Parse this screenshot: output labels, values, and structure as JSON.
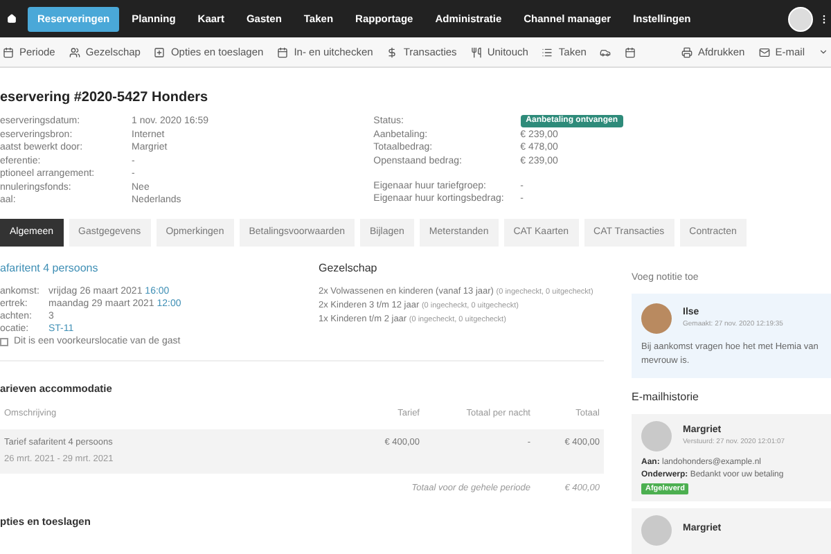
{
  "nav": {
    "items": [
      {
        "label": "Reserveringen",
        "selected": true
      },
      {
        "label": "Planning",
        "selected": false
      },
      {
        "label": "Kaart",
        "selected": false
      },
      {
        "label": "Gasten",
        "selected": false
      },
      {
        "label": "Taken",
        "selected": false
      },
      {
        "label": "Rapportage",
        "selected": false
      },
      {
        "label": "Administratie",
        "selected": false
      },
      {
        "label": "Channel manager",
        "selected": false
      },
      {
        "label": "Instellingen",
        "selected": false
      }
    ]
  },
  "toolbar": {
    "left": [
      {
        "label": "Periode",
        "kind": "calendar"
      },
      {
        "label": "Gezelschap",
        "kind": "users"
      },
      {
        "label": "Opties en toeslagen",
        "kind": "plus"
      },
      {
        "label": "In- en uitchecken",
        "kind": "calendar"
      },
      {
        "label": "Transacties",
        "kind": "money"
      },
      {
        "label": "Unitouch",
        "kind": "cutlery"
      },
      {
        "label": "Taken",
        "kind": "list"
      },
      {
        "kind": "car"
      },
      {
        "kind": "calendar"
      }
    ],
    "right": [
      {
        "label": "Afdrukken",
        "kind": "print"
      },
      {
        "label": "E-mail",
        "kind": "mail"
      }
    ]
  },
  "reservation": {
    "title": "eservering #2020-5427 Honders",
    "left": [
      {
        "label": "eserveringsdatum:",
        "value": "1 nov. 2020 16:59"
      },
      {
        "label": "eserveringsbron:",
        "value": "Internet"
      },
      {
        "label": "aatst bewerkt door:",
        "value": "Margriet"
      },
      {
        "label": "eferentie:",
        "value": "-"
      },
      {
        "label": "ptioneel arrangement:",
        "value": "-"
      },
      {
        "label": "nnuleringsfonds:",
        "value": "Nee"
      },
      {
        "label": "aal:",
        "value": "Nederlands"
      }
    ],
    "right": [
      [
        {
          "label": "Status:",
          "value": "Aanbetaling ontvangen",
          "kind": "badge"
        },
        {
          "label": "Aanbetaling:",
          "value": "€ 239,00",
          "kind": "text"
        },
        {
          "label": "Totaalbedrag:",
          "value": "€ 478,00",
          "kind": "text"
        },
        {
          "label": "Openstaand bedrag:",
          "value": "€ 239,00",
          "kind": "text"
        }
      ],
      [
        {
          "label": "Eigenaar huur tariefgroep:",
          "value": "-",
          "kind": "text"
        },
        {
          "label": "Eigenaar huur kortingsbedrag:",
          "value": "-",
          "kind": "text"
        }
      ]
    ]
  },
  "tabs": [
    {
      "label": "Algemeen",
      "selected": true
    },
    {
      "label": "Gastgegevens",
      "selected": false
    },
    {
      "label": "Opmerkingen",
      "selected": false
    },
    {
      "label": "Betalingsvoorwaarden",
      "selected": false
    },
    {
      "label": "Bijlagen",
      "selected": false
    },
    {
      "label": "Meterstanden",
      "selected": false
    },
    {
      "label": "CAT Kaarten",
      "selected": false
    },
    {
      "label": "CAT Transacties",
      "selected": false
    },
    {
      "label": "Contracten",
      "selected": false
    }
  ],
  "stay": {
    "title": "afaritent 4 persoons",
    "rows": [
      {
        "label": "ankomst:",
        "value": "vrijdag 26 maart 2021",
        "time": "16:00",
        "kind": "text"
      },
      {
        "label": "ertrek:",
        "value": "maandag 29 maart 2021",
        "time": "12:00",
        "kind": "text"
      },
      {
        "label": "achten:",
        "value": "3",
        "kind": "text"
      },
      {
        "label": "ocatie:",
        "value": "ST-11",
        "kind": "link"
      }
    ],
    "checkbox": {
      "label": "Dit is een voorkeurslocatie van de gast",
      "checked": false
    }
  },
  "party": {
    "title": "Gezelschap",
    "items": [
      {
        "text": "2x Volwassenen en kinderen (vanaf 13 jaar)",
        "note": "(0 ingecheckt, 0 uitgecheckt)"
      },
      {
        "text": "2x Kinderen 3 t/m 12 jaar",
        "note": "(0 ingecheckt, 0 uitgecheckt)"
      },
      {
        "text": "1x Kinderen t/m 2 jaar",
        "note": "(0 ingecheckt, 0 uitgecheckt)"
      }
    ]
  },
  "rates": {
    "title": "arieven accommodatie",
    "columns": [
      "Omschrijving",
      "Tarief",
      "Totaal per nacht",
      "Totaal"
    ],
    "rows": [
      {
        "description": "Tarief safaritent 4 persoons",
        "dates": "26 mrt. 2021 - 29 mrt. 2021",
        "rate": "€ 400,00",
        "per_night": "-",
        "total": "€ 400,00"
      }
    ],
    "total": {
      "label": "Totaal voor de gehele periode",
      "value": "€ 400,00"
    }
  },
  "options": {
    "title": "pties en toeslagen"
  },
  "notes": {
    "add_label": "Voeg notitie toe",
    "items": [
      {
        "author": "Ilse",
        "meta": "Gemaakt: 27 nov. 2020 12:19:35",
        "text": "Bij aankomst vragen hoe het met Hemia van mevrouw is."
      }
    ]
  },
  "email": {
    "title": "E-mailhistorie",
    "items": [
      {
        "author": "Margriet",
        "meta": "Verstuurd: 27 nov. 2020 12:01:07",
        "to_label": "Aan:",
        "to": "landohonders@example.nl",
        "subject_label": "Onderwerp:",
        "subject": "Bedankt voor uw betaling",
        "badge": "Afgeleverd"
      },
      {
        "author": "Margriet"
      }
    ]
  }
}
